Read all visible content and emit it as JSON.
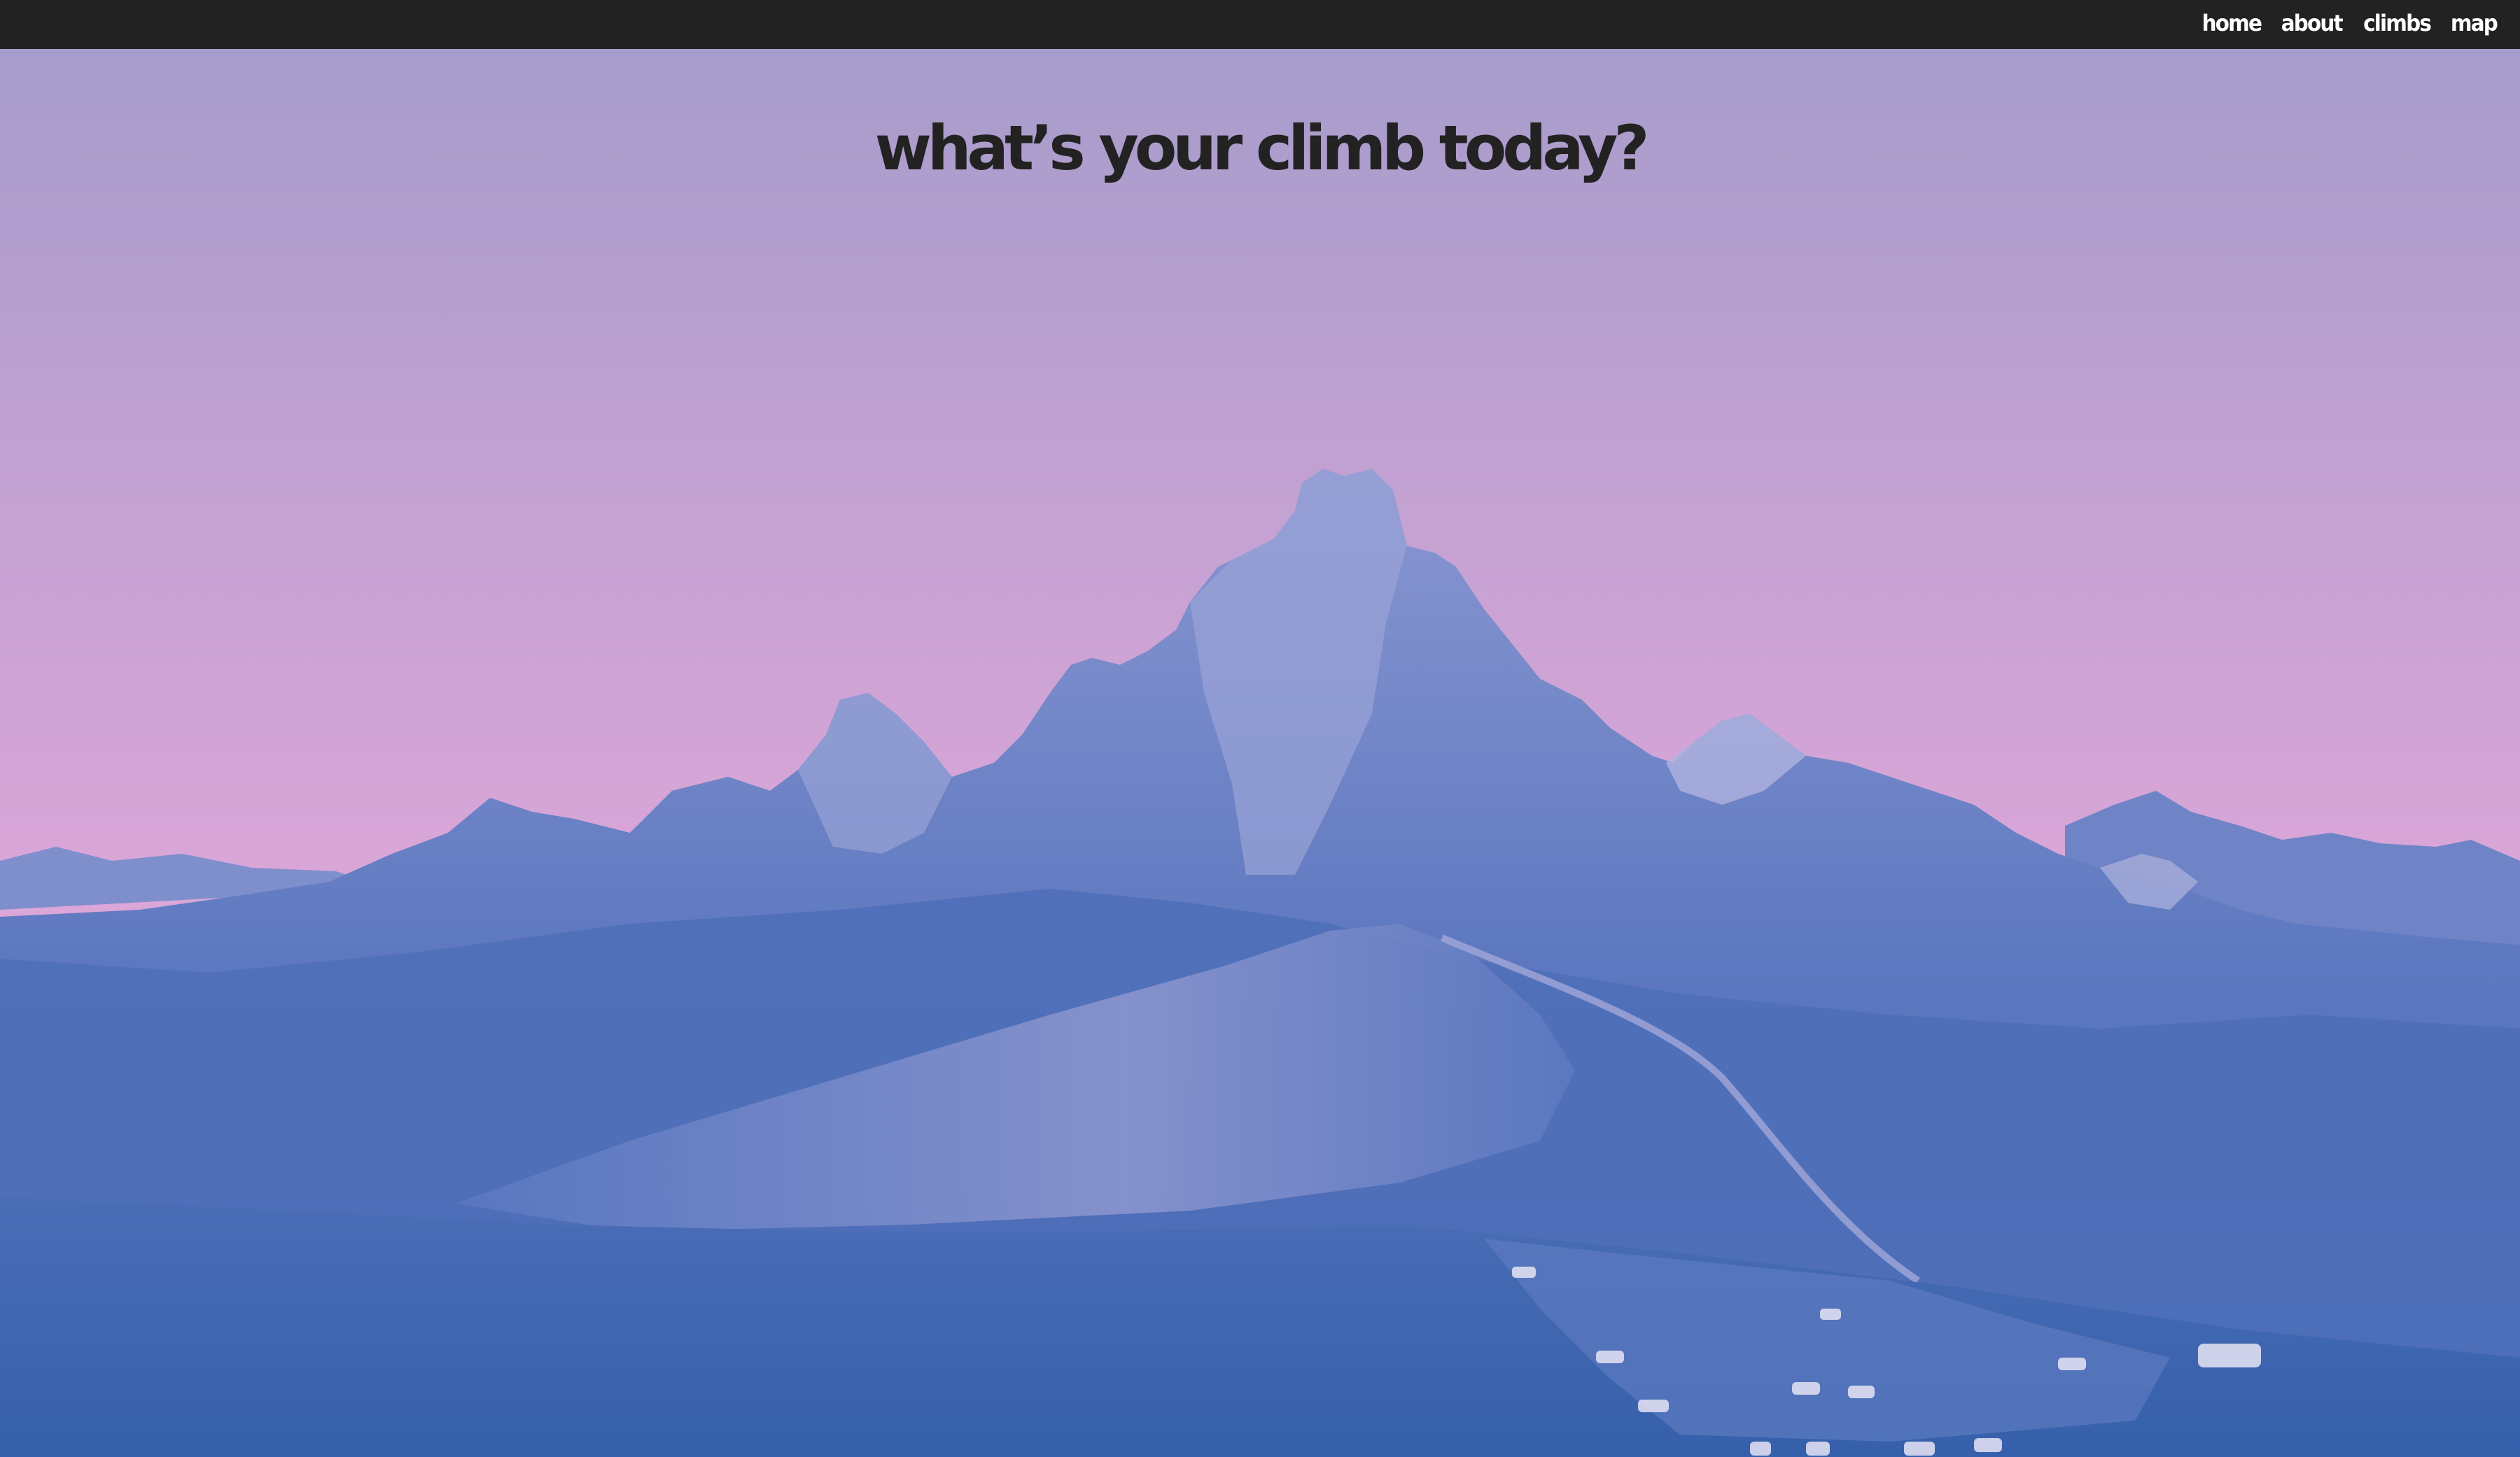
{
  "nav": {
    "items": [
      {
        "label": "home"
      },
      {
        "label": "about"
      },
      {
        "label": "climbs"
      },
      {
        "label": "map"
      }
    ]
  },
  "hero": {
    "headline": "what’s your climb today?"
  },
  "colors": {
    "topbar": "#222222",
    "nav_text": "#ffffff",
    "headline_text": "#222222",
    "sky_top": "#a69ccb",
    "sky_bottom": "#dba6d8",
    "mountain_base": "#3a63ad",
    "mountain_light": "#8a95cf"
  }
}
